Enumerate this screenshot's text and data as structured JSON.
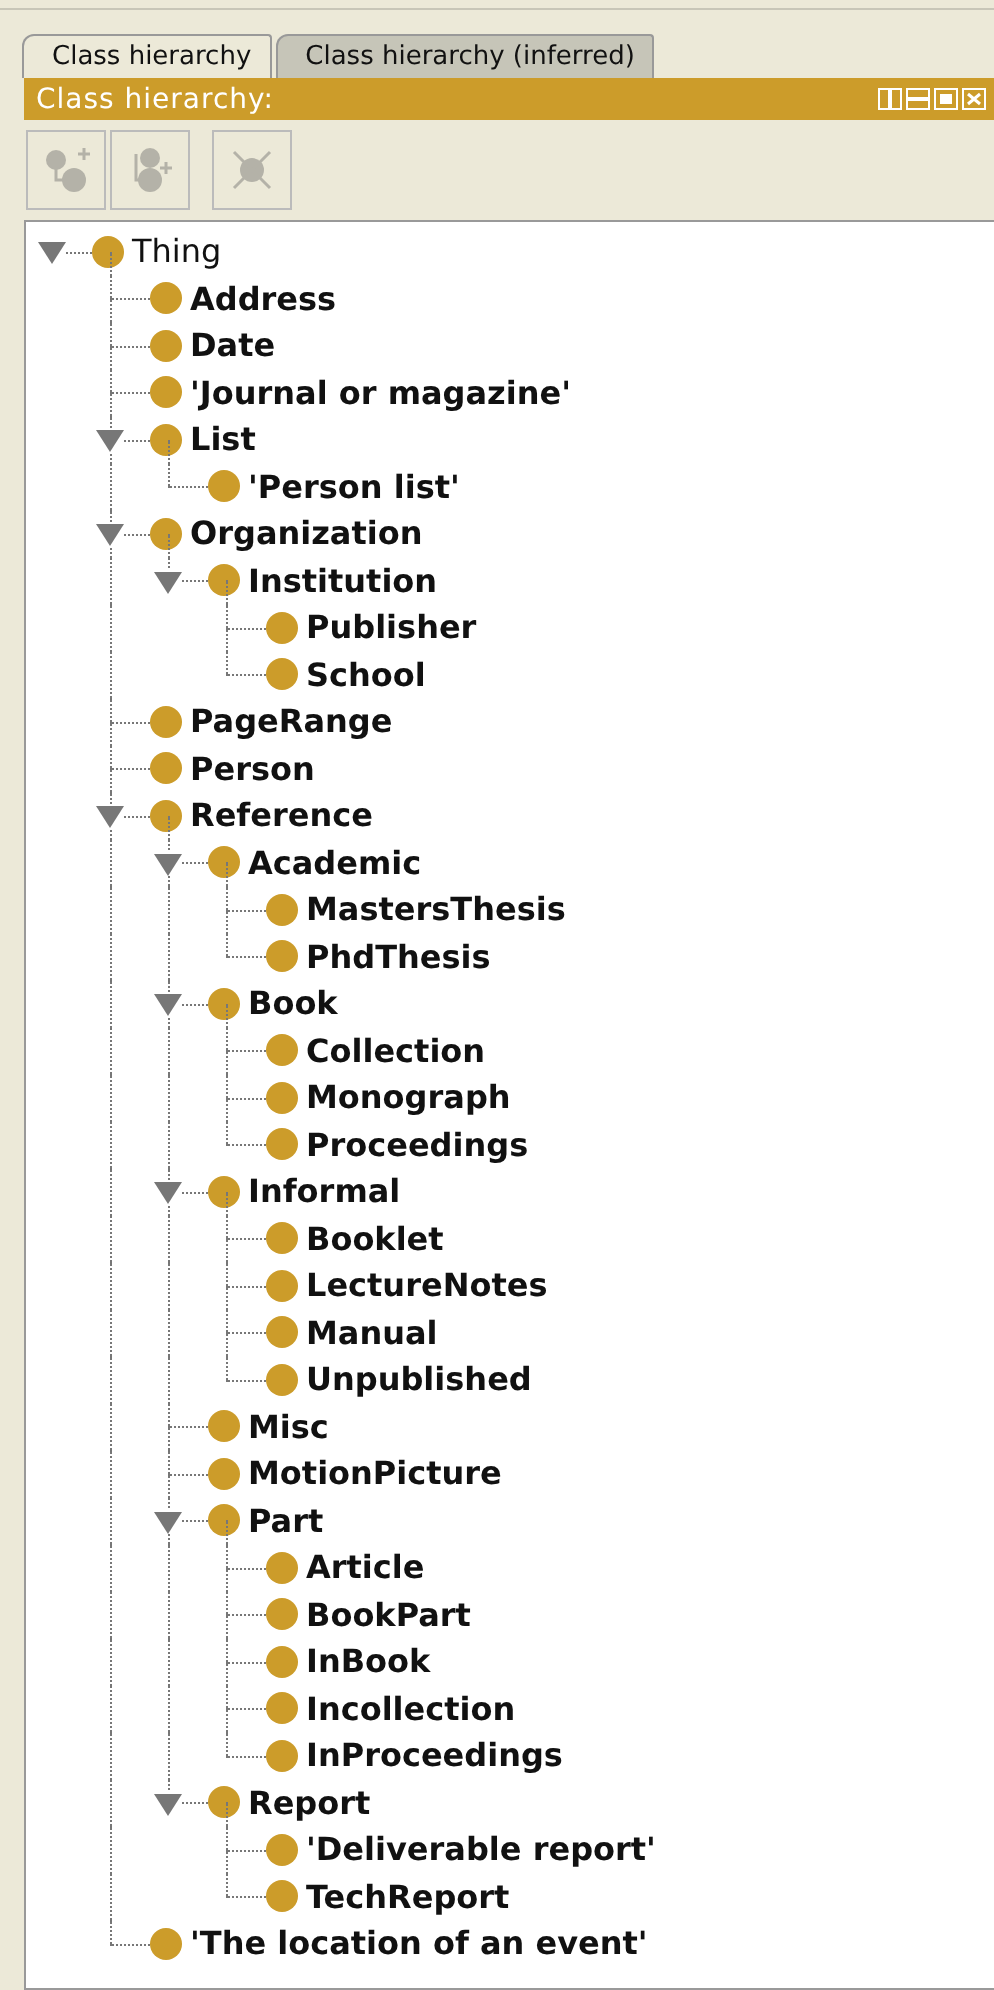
{
  "tabs": [
    {
      "label": "Class hierarchy",
      "selected": true
    },
    {
      "label": "Class hierarchy (inferred)",
      "selected": false
    }
  ],
  "panel": {
    "title": "Class hierarchy:"
  },
  "toolbar": [
    {
      "kind": "add-subclass",
      "disabled": true
    },
    {
      "kind": "add-sibling",
      "disabled": true
    },
    {
      "kind": "delete",
      "disabled": true
    }
  ],
  "tree": [
    {
      "label": "Thing",
      "bold": false,
      "expanded": true,
      "children": [
        {
          "label": "Address",
          "bold": true
        },
        {
          "label": "Date",
          "bold": true
        },
        {
          "label": "'Journal or magazine'",
          "bold": true
        },
        {
          "label": "List",
          "bold": true,
          "expanded": true,
          "children": [
            {
              "label": "'Person list'",
              "bold": true
            }
          ]
        },
        {
          "label": "Organization",
          "bold": true,
          "expanded": true,
          "children": [
            {
              "label": "Institution",
              "bold": true,
              "expanded": true,
              "children": [
                {
                  "label": "Publisher",
                  "bold": true
                },
                {
                  "label": "School",
                  "bold": true
                }
              ]
            }
          ]
        },
        {
          "label": "PageRange",
          "bold": true
        },
        {
          "label": "Person",
          "bold": true
        },
        {
          "label": "Reference",
          "bold": true,
          "expanded": true,
          "children": [
            {
              "label": "Academic",
              "bold": true,
              "expanded": true,
              "children": [
                {
                  "label": "MastersThesis",
                  "bold": true
                },
                {
                  "label": "PhdThesis",
                  "bold": true
                }
              ]
            },
            {
              "label": "Book",
              "bold": true,
              "expanded": true,
              "children": [
                {
                  "label": "Collection",
                  "bold": true
                },
                {
                  "label": "Monograph",
                  "bold": true
                },
                {
                  "label": "Proceedings",
                  "bold": true
                }
              ]
            },
            {
              "label": "Informal",
              "bold": true,
              "expanded": true,
              "children": [
                {
                  "label": "Booklet",
                  "bold": true
                },
                {
                  "label": "LectureNotes",
                  "bold": true
                },
                {
                  "label": "Manual",
                  "bold": true
                },
                {
                  "label": "Unpublished",
                  "bold": true
                }
              ]
            },
            {
              "label": "Misc",
              "bold": true
            },
            {
              "label": "MotionPicture",
              "bold": true
            },
            {
              "label": "Part",
              "bold": true,
              "expanded": true,
              "children": [
                {
                  "label": "Article",
                  "bold": true
                },
                {
                  "label": "BookPart",
                  "bold": true
                },
                {
                  "label": "InBook",
                  "bold": true
                },
                {
                  "label": "Incollection",
                  "bold": true
                },
                {
                  "label": "InProceedings",
                  "bold": true
                }
              ]
            },
            {
              "label": "Report",
              "bold": true,
              "expanded": true,
              "children": [
                {
                  "label": "'Deliverable report'",
                  "bold": true
                },
                {
                  "label": "TechReport",
                  "bold": true
                }
              ]
            }
          ]
        },
        {
          "label": "'The location of an event'",
          "bold": true
        }
      ]
    }
  ]
}
